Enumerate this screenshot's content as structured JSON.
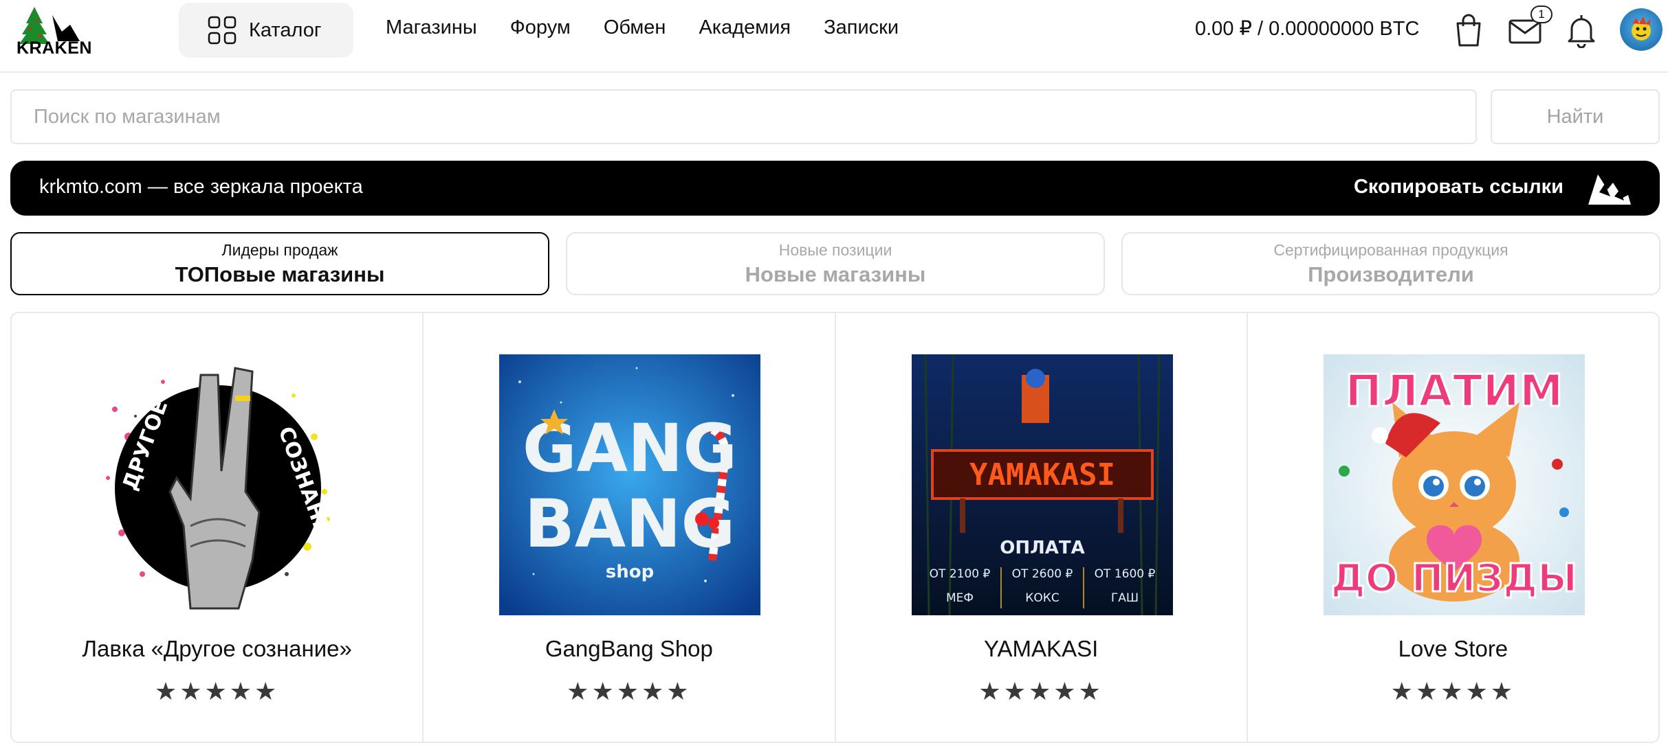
{
  "header": {
    "logo_text": "KRAKEN",
    "catalog_label": "Каталог",
    "nav": [
      "Магазины",
      "Форум",
      "Обмен",
      "Академия",
      "Записки"
    ],
    "balance": "0.00 ₽ / 0.00000000 BTC",
    "mail_count": "1"
  },
  "search": {
    "placeholder": "Поиск по магазинам",
    "button_label": "Найти"
  },
  "banner": {
    "text": "krkmto.com — все зеркала проекта",
    "copy_label": "Скопировать ссылки"
  },
  "tabs": [
    {
      "sub": "Лидеры продаж",
      "main": "ТОПовые магазины",
      "active": true
    },
    {
      "sub": "Новые позиции",
      "main": "Новые магазины",
      "active": false
    },
    {
      "sub": "Сертифицированная продукция",
      "main": "Производители",
      "active": false
    }
  ],
  "shops": [
    {
      "name": "Лавка «Другое сознание»",
      "rating": 5,
      "image_text": {
        "left": "ДРУГОЕ",
        "right": "СОЗНАНИЕ"
      }
    },
    {
      "name": "GangBang Shop",
      "rating": 5,
      "image_text": {
        "line1": "GANG",
        "line2": "BANG",
        "line3": "shop"
      }
    },
    {
      "name": "YAMAKASI",
      "rating": 5,
      "image_text": {
        "sign": "YAMAKASI",
        "pay": "ОПЛАТА",
        "prices": [
          "ОТ 2100 ₽",
          "ОТ 2600 ₽",
          "ОТ 1600 ₽"
        ],
        "items": [
          "МЕФ",
          "КОКС",
          "ГАШ"
        ]
      }
    },
    {
      "name": "Love Store",
      "rating": 5,
      "image_text": {
        "top": "ПЛАТИМ",
        "bottom": "ДО ПИЗДЫ"
      }
    }
  ],
  "colors": {
    "banner_bg": "#000000",
    "border": "#e6e6e6",
    "muted_text": "#a8a8a8",
    "star": "#3a3a3a"
  }
}
